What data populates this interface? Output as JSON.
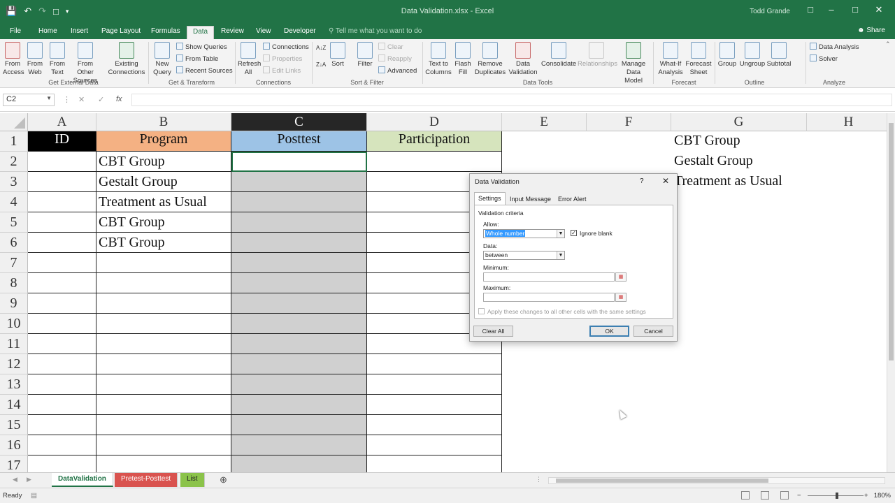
{
  "window": {
    "title": "Data Validation.xlsx - Excel",
    "user": "Todd Grande"
  },
  "tabs": [
    "File",
    "Home",
    "Insert",
    "Page Layout",
    "Formulas",
    "Data",
    "Review",
    "View",
    "Developer"
  ],
  "active_tab": "Data",
  "tell_me": "Tell me what you want to do",
  "share": "Share",
  "ribbon": {
    "from_access": "From Access",
    "from_web": "From Web",
    "from_text": "From Text",
    "from_other": "From Other Sources",
    "existing": "Existing Connections",
    "new_query": "New Query",
    "show_queries": "Show Queries",
    "from_table": "From Table",
    "recent_sources": "Recent Sources",
    "refresh_all": "Refresh All",
    "connections": "Connections",
    "properties": "Properties",
    "edit_links": "Edit Links",
    "sort": "Sort",
    "filter": "Filter",
    "clear": "Clear",
    "reapply": "Reapply",
    "advanced": "Advanced",
    "text_to_columns": "Text to Columns",
    "flash_fill": "Flash Fill",
    "remove_duplicates": "Remove Duplicates",
    "data_validation": "Data Validation",
    "consolidate": "Consolidate",
    "relationships": "Relationships",
    "manage_data_model": "Manage Data Model",
    "what_if": "What-If Analysis",
    "forecast_sheet": "Forecast Sheet",
    "group": "Group",
    "ungroup": "Ungroup",
    "subtotal": "Subtotal",
    "data_analysis": "Data Analysis",
    "solver": "Solver",
    "groups": {
      "get_external": "Get External Data",
      "get_transform": "Get & Transform",
      "connections": "Connections",
      "sort_filter": "Sort & Filter",
      "data_tools": "Data Tools",
      "forecast": "Forecast",
      "outline": "Outline",
      "analyze": "Analyze"
    }
  },
  "formula_bar": {
    "name_box": "C2",
    "fx": "fx",
    "cancel": "✕",
    "enter": "✓"
  },
  "columns": [
    "A",
    "B",
    "C",
    "D",
    "E",
    "F",
    "G",
    "H"
  ],
  "rows": [
    "1",
    "2",
    "3",
    "4",
    "5",
    "6",
    "7",
    "8",
    "9",
    "10",
    "11",
    "12",
    "13",
    "14",
    "15",
    "16",
    "17"
  ],
  "headers": {
    "id": "ID",
    "program": "Program",
    "posttest": "Posttest",
    "participation": "Participation"
  },
  "program_values": [
    "CBT Group",
    "Gestalt Group",
    "Treatment as Usual",
    "CBT Group",
    "CBT Group"
  ],
  "list_values": [
    "CBT Group",
    "Gestalt Group",
    "Treatment as Usual"
  ],
  "colors": {
    "excel_green": "#217346",
    "id_header": "#000000",
    "program_header": "#f4b183",
    "posttest_header": "#9dc3e6",
    "participation_header": "#d6e4bd",
    "posttest_fill": "#d0d0d0"
  },
  "dialog": {
    "title": "Data Validation",
    "help": "?",
    "close": "✕",
    "tabs": [
      "Settings",
      "Input Message",
      "Error Alert"
    ],
    "validation_criteria": "Validation criteria",
    "allow_label": "Allow:",
    "allow_value": "Whole number",
    "ignore_blank": "Ignore blank",
    "data_label": "Data:",
    "data_value": "between",
    "minimum_label": "Minimum:",
    "maximum_label": "Maximum:",
    "apply_all": "Apply these changes to all other cells with the same settings",
    "clear_all": "Clear All",
    "ok": "OK",
    "cancel": "Cancel"
  },
  "sheets": [
    "DataValidation",
    "Pretest-Posttest",
    "List"
  ],
  "sheet_colors": [
    "#ffffff",
    "#d9534f",
    "#8bc34a"
  ],
  "status": {
    "ready": "Ready",
    "zoom": "180%"
  }
}
